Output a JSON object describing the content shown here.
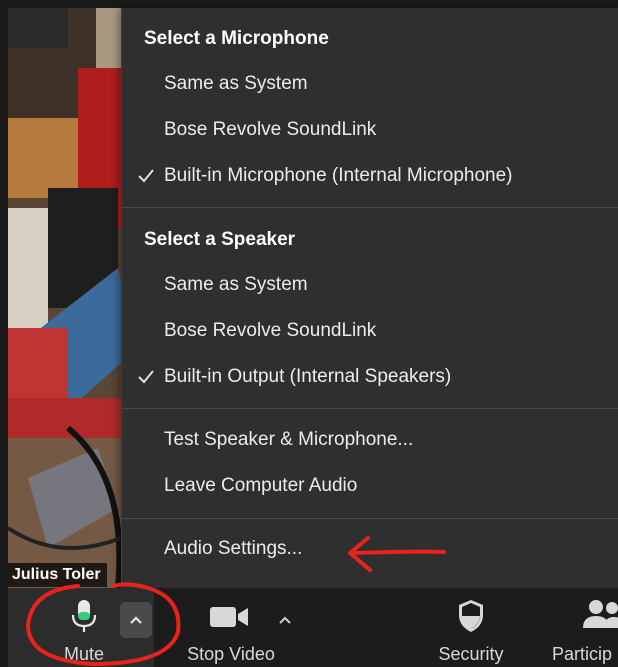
{
  "video": {
    "participant_name": "Julius Toler"
  },
  "menu": {
    "microphone_header": "Select a Microphone",
    "microphone_options": [
      {
        "label": "Same as System",
        "checked": false
      },
      {
        "label": "Bose Revolve SoundLink",
        "checked": false
      },
      {
        "label": "Built-in Microphone (Internal Microphone)",
        "checked": true
      }
    ],
    "speaker_header": "Select a Speaker",
    "speaker_options": [
      {
        "label": "Same as System",
        "checked": false
      },
      {
        "label": "Bose Revolve SoundLink",
        "checked": false
      },
      {
        "label": "Built-in Output (Internal Speakers)",
        "checked": true
      }
    ],
    "test_label": "Test Speaker & Microphone...",
    "leave_label": "Leave Computer Audio",
    "settings_label": "Audio Settings..."
  },
  "toolbar": {
    "mute_label": "Mute",
    "video_label": "Stop Video",
    "security_label": "Security",
    "participants_label": "Particip"
  },
  "colors": {
    "menu_bg": "#2f2f2f",
    "toolbar_bg": "#1c1c1c",
    "mic_active": "#2fd17a",
    "annotation": "#e8231b"
  }
}
